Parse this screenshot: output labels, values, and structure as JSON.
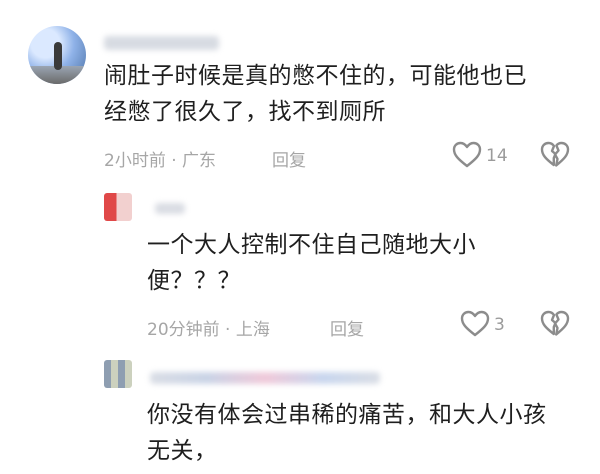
{
  "comments": [
    {
      "username": "",
      "text_lines": [
        "闹肚子时候是真的憋不住的，可能他也已",
        "经憋了很久了，找不到厕所"
      ],
      "meta": "2小时前 · 广东",
      "reply_label": "回复",
      "like_count": "14"
    },
    {
      "username": "",
      "text_lines": [
        "一个大人控制不住自己随地大小",
        "便？？？"
      ],
      "meta": "20分钟前 · 上海",
      "reply_label": "回复",
      "like_count": "3"
    },
    {
      "username": "",
      "text_lines": [
        "你没有体会过串稀的痛苦，和大人小孩",
        "无关，"
      ],
      "meta": "",
      "reply_label": "",
      "like_count": ""
    }
  ],
  "colors": {
    "text": "#1f1f1f",
    "meta": "#a6a6a6",
    "icon": "#8c8c8c"
  },
  "icons": [
    "heart-icon",
    "broken-heart-icon"
  ]
}
